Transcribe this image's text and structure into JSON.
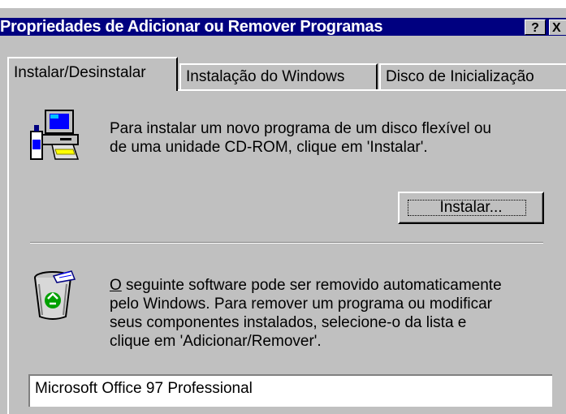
{
  "window": {
    "title": "Propriedades de Adicionar ou Remover Programas",
    "help_label": "?",
    "close_label": "X"
  },
  "tabs": [
    {
      "label": "Instalar/Desinstalar",
      "active": true
    },
    {
      "label": "Instalação do Windows",
      "active": false
    },
    {
      "label": "Disco de Inicialização",
      "active": false
    }
  ],
  "install": {
    "description_line1": "Para instalar um novo programa de um disco flexível ou",
    "description_line2": "de uma unidade CD-ROM, clique em 'Instalar'.",
    "button_label": "Instalar...",
    "icon": "computer-install-icon"
  },
  "remove": {
    "description_line1_rest": " seguinte software pode ser removido automaticamente",
    "description_line1_accel": "O",
    "description_line2": "pelo Windows. Para remover um programa ou modificar",
    "description_line3": "seus componentes instalados, selecione-o da lista e",
    "description_line4": "clique em 'Adicionar/Remover'.",
    "icon": "recycle-bin-icon"
  },
  "software_list": [
    "Microsoft Office 97 Professional"
  ],
  "colors": {
    "titlebar": "#000080",
    "face": "#c0c0c0"
  }
}
